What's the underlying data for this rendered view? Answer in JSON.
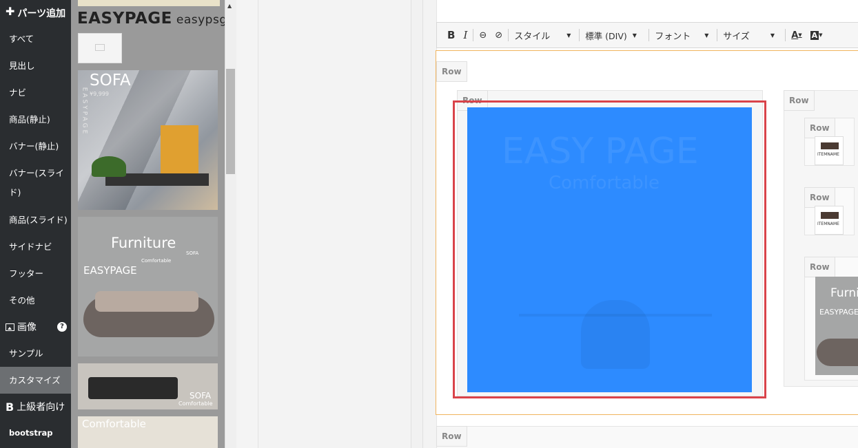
{
  "sidebar": {
    "header": "パーツ追加",
    "items": [
      {
        "label": "すべて"
      },
      {
        "label": "見出し"
      },
      {
        "label": "ナビ"
      },
      {
        "label": "商品(静止)"
      },
      {
        "label": "バナー(静止)"
      },
      {
        "label": "バナー(スライド)"
      },
      {
        "label": "商品(スライド)"
      },
      {
        "label": "サイドナビ"
      },
      {
        "label": "フッター"
      },
      {
        "label": "その他"
      }
    ],
    "image_section": "画像",
    "image_items": [
      {
        "label": "サンプル"
      },
      {
        "label": "カスタマイズ"
      }
    ],
    "advanced_section": "上級者向け",
    "advanced_items": [
      {
        "label": "bootstrap"
      }
    ]
  },
  "thumbnails": {
    "title": "EASYPAGE",
    "subtitle": "easypsge",
    "card1": {
      "title": "SOFA",
      "price": "¥9,999",
      "vertical": "EASYPAGE"
    },
    "card2": {
      "title": "Furniture",
      "brand": "EASYPAGE",
      "small1": "Comfortable",
      "small2": "SOFA"
    },
    "card3": {
      "title": "SOFA",
      "small": "Comfortable"
    },
    "card4": {
      "title": "Comfortable"
    }
  },
  "toolbar": {
    "bold": "B",
    "italic": "I",
    "style": "スタイル",
    "format": "標準 (DIV)",
    "font": "フォント",
    "size": "サイズ"
  },
  "canvas": {
    "row_label": "Row",
    "watermark_title": "EASY PAGE",
    "watermark_sub": "Comfortable",
    "mini_label": "ITEMNAME"
  },
  "colors": {
    "sidebar_bg": "#2a2d30",
    "selection_blue": "#2d8bff",
    "highlight_red": "#d9434a",
    "row_border_orange": "#f0b35c"
  }
}
